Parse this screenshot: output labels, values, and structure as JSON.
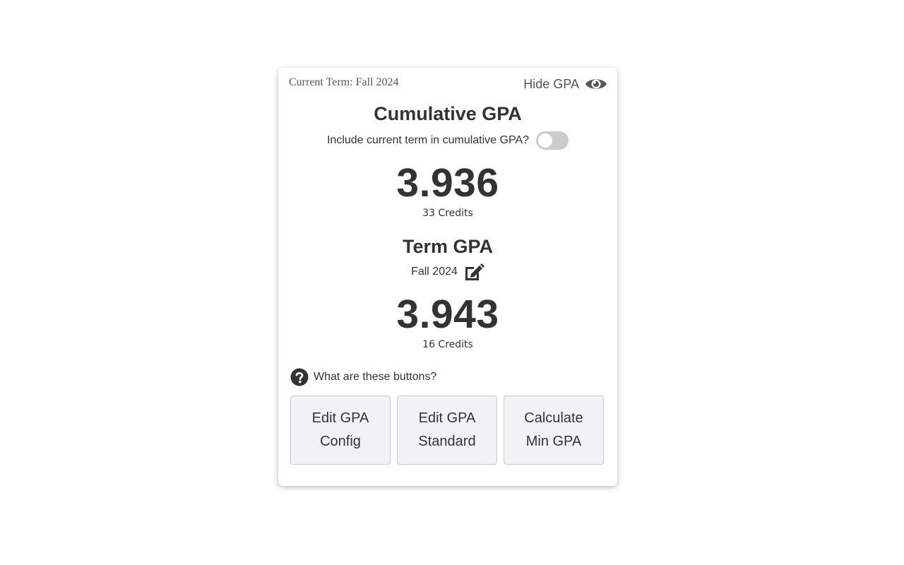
{
  "header": {
    "current_term": "Current Term: Fall 2024",
    "hide_gpa_label": "Hide GPA",
    "hide_icon": "eye-icon"
  },
  "cumulative": {
    "title": "Cumulative GPA",
    "toggle_label": "Include current term in cumulative GPA?",
    "toggle_on": false,
    "gpa": "3.936",
    "credits": "33 Credits"
  },
  "term": {
    "title": "Term GPA",
    "term_name": "Fall 2024",
    "edit_icon": "edit-icon",
    "gpa": "3.943",
    "credits": "16 Credits"
  },
  "help": {
    "label": "What are these buttons?",
    "icon": "question-circle-icon"
  },
  "buttons": [
    {
      "label": "Edit GPA Config"
    },
    {
      "label": "Edit GPA Standard"
    },
    {
      "label": "Calculate Min GPA"
    }
  ],
  "colors": {
    "text": "#333333",
    "muted": "#555555",
    "toggle_off": "#cccccc",
    "button_bg": "#f1f2f3",
    "button_border": "#c8cbcf"
  }
}
